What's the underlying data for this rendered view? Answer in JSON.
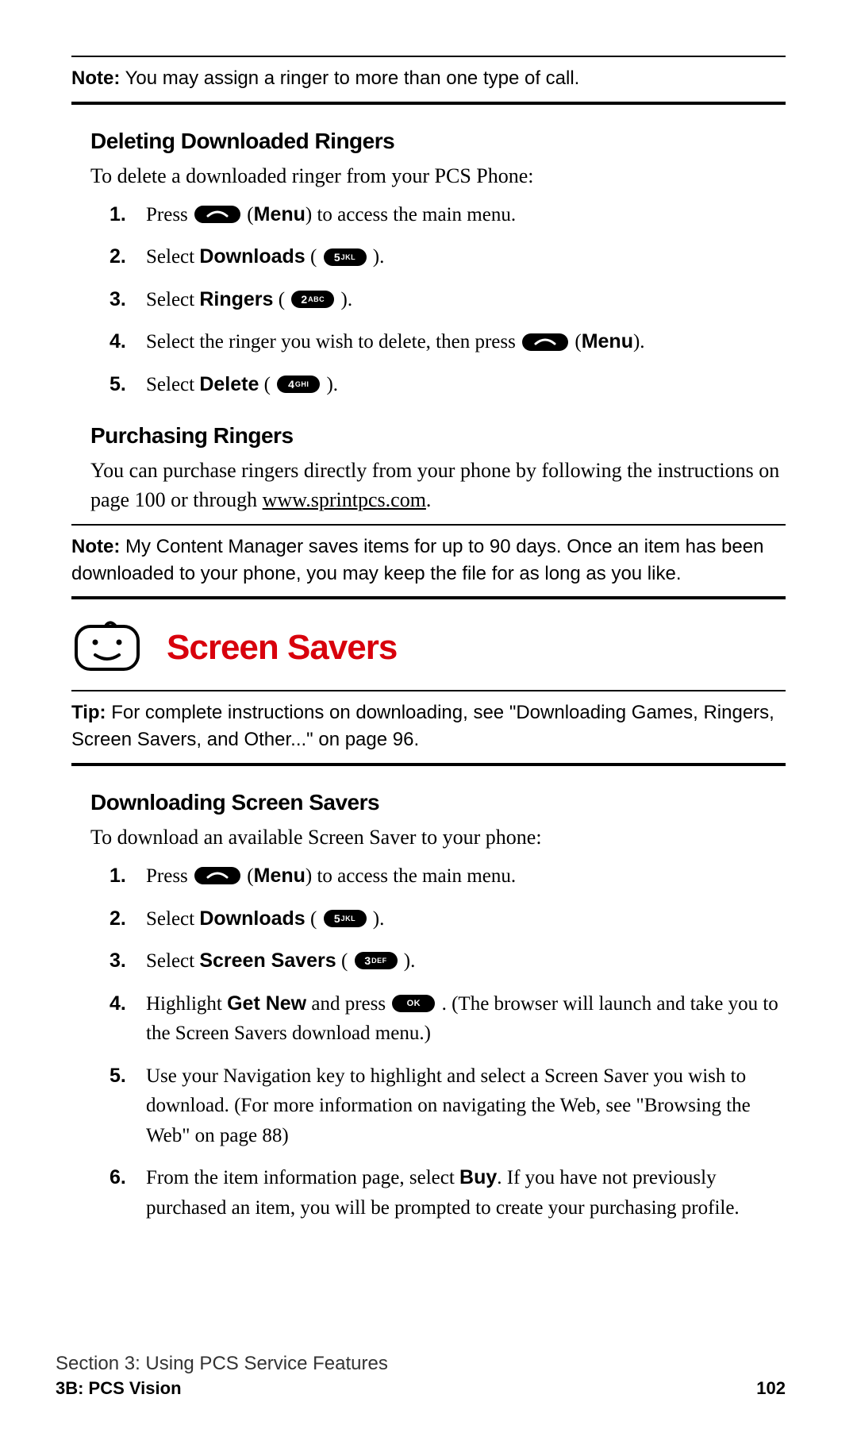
{
  "note1": {
    "label": "Note:",
    "text": " You may assign a ringer to more than one type of call."
  },
  "deleting": {
    "heading": "Deleting Downloaded Ringers",
    "intro": "To delete a downloaded ringer from your PCS Phone:",
    "steps": {
      "s1_a": "Press ",
      "s1_b": " (",
      "s1_menu": "Menu",
      "s1_c": ") to access the main menu.",
      "s2_a": "Select ",
      "s2_b": "Downloads",
      "s2_c": " ( ",
      "s2_d": " ).",
      "s3_a": "Select ",
      "s3_b": "Ringers",
      "s3_c": " ( ",
      "s3_d": " ).",
      "s4_a": "Select the ringer you wish to delete, then press ",
      "s4_b": " (",
      "s4_menu": "Menu",
      "s4_c": ").",
      "s5_a": "Select ",
      "s5_b": "Delete",
      "s5_c": " ( ",
      "s5_d": " )."
    }
  },
  "purchasing": {
    "heading": "Purchasing Ringers",
    "text_a": "You can purchase ringers directly from your phone by following the instructions on page 100 or through ",
    "link": "www.sprintpcs.com",
    "text_b": "."
  },
  "note2": {
    "label": "Note:",
    "text": " My Content Manager saves items for up to 90 days. Once an item has been downloaded to your phone, you may keep the file for as long as you like."
  },
  "screen_savers_title": "Screen Savers",
  "tip": {
    "label": "Tip:",
    "text": " For complete instructions on downloading, see \"Downloading Games, Ringers, Screen Savers, and Other...\" on page 96."
  },
  "downloading": {
    "heading": "Downloading Screen Savers",
    "intro": "To download an available Screen Saver to your phone:",
    "steps": {
      "s1_a": "Press ",
      "s1_b": " (",
      "s1_menu": "Menu",
      "s1_c": ") to access the main menu.",
      "s2_a": "Select ",
      "s2_b": "Downloads",
      "s2_c": " ( ",
      "s2_d": " ).",
      "s3_a": "Select ",
      "s3_b": "Screen Savers",
      "s3_c": " ( ",
      "s3_d": " ).",
      "s4_a": "Highlight ",
      "s4_b": "Get New",
      "s4_c": " and press ",
      "s4_d": " . (The browser will launch and take you to the Screen Savers download menu.)",
      "s5": "Use your Navigation key to highlight and select a Screen Saver you wish to download. (For more information on navigating the Web, see \"Browsing the Web\" on page 88)",
      "s6_a": "From the item information page, select ",
      "s6_b": "Buy",
      "s6_c": ". If you have not previously purchased an item, you will be prompted to create your purchasing profile."
    }
  },
  "keys": {
    "five": {
      "num": "5",
      "letters": "JKL"
    },
    "two": {
      "num": "2",
      "letters": "ABC"
    },
    "four": {
      "num": "4",
      "letters": "GHI"
    },
    "three": {
      "num": "3",
      "letters": "DEF"
    },
    "ok": {
      "label": "OK"
    }
  },
  "footer": {
    "section": "Section 3: Using PCS Service Features",
    "sub": "3B: PCS Vision",
    "page": "102"
  }
}
